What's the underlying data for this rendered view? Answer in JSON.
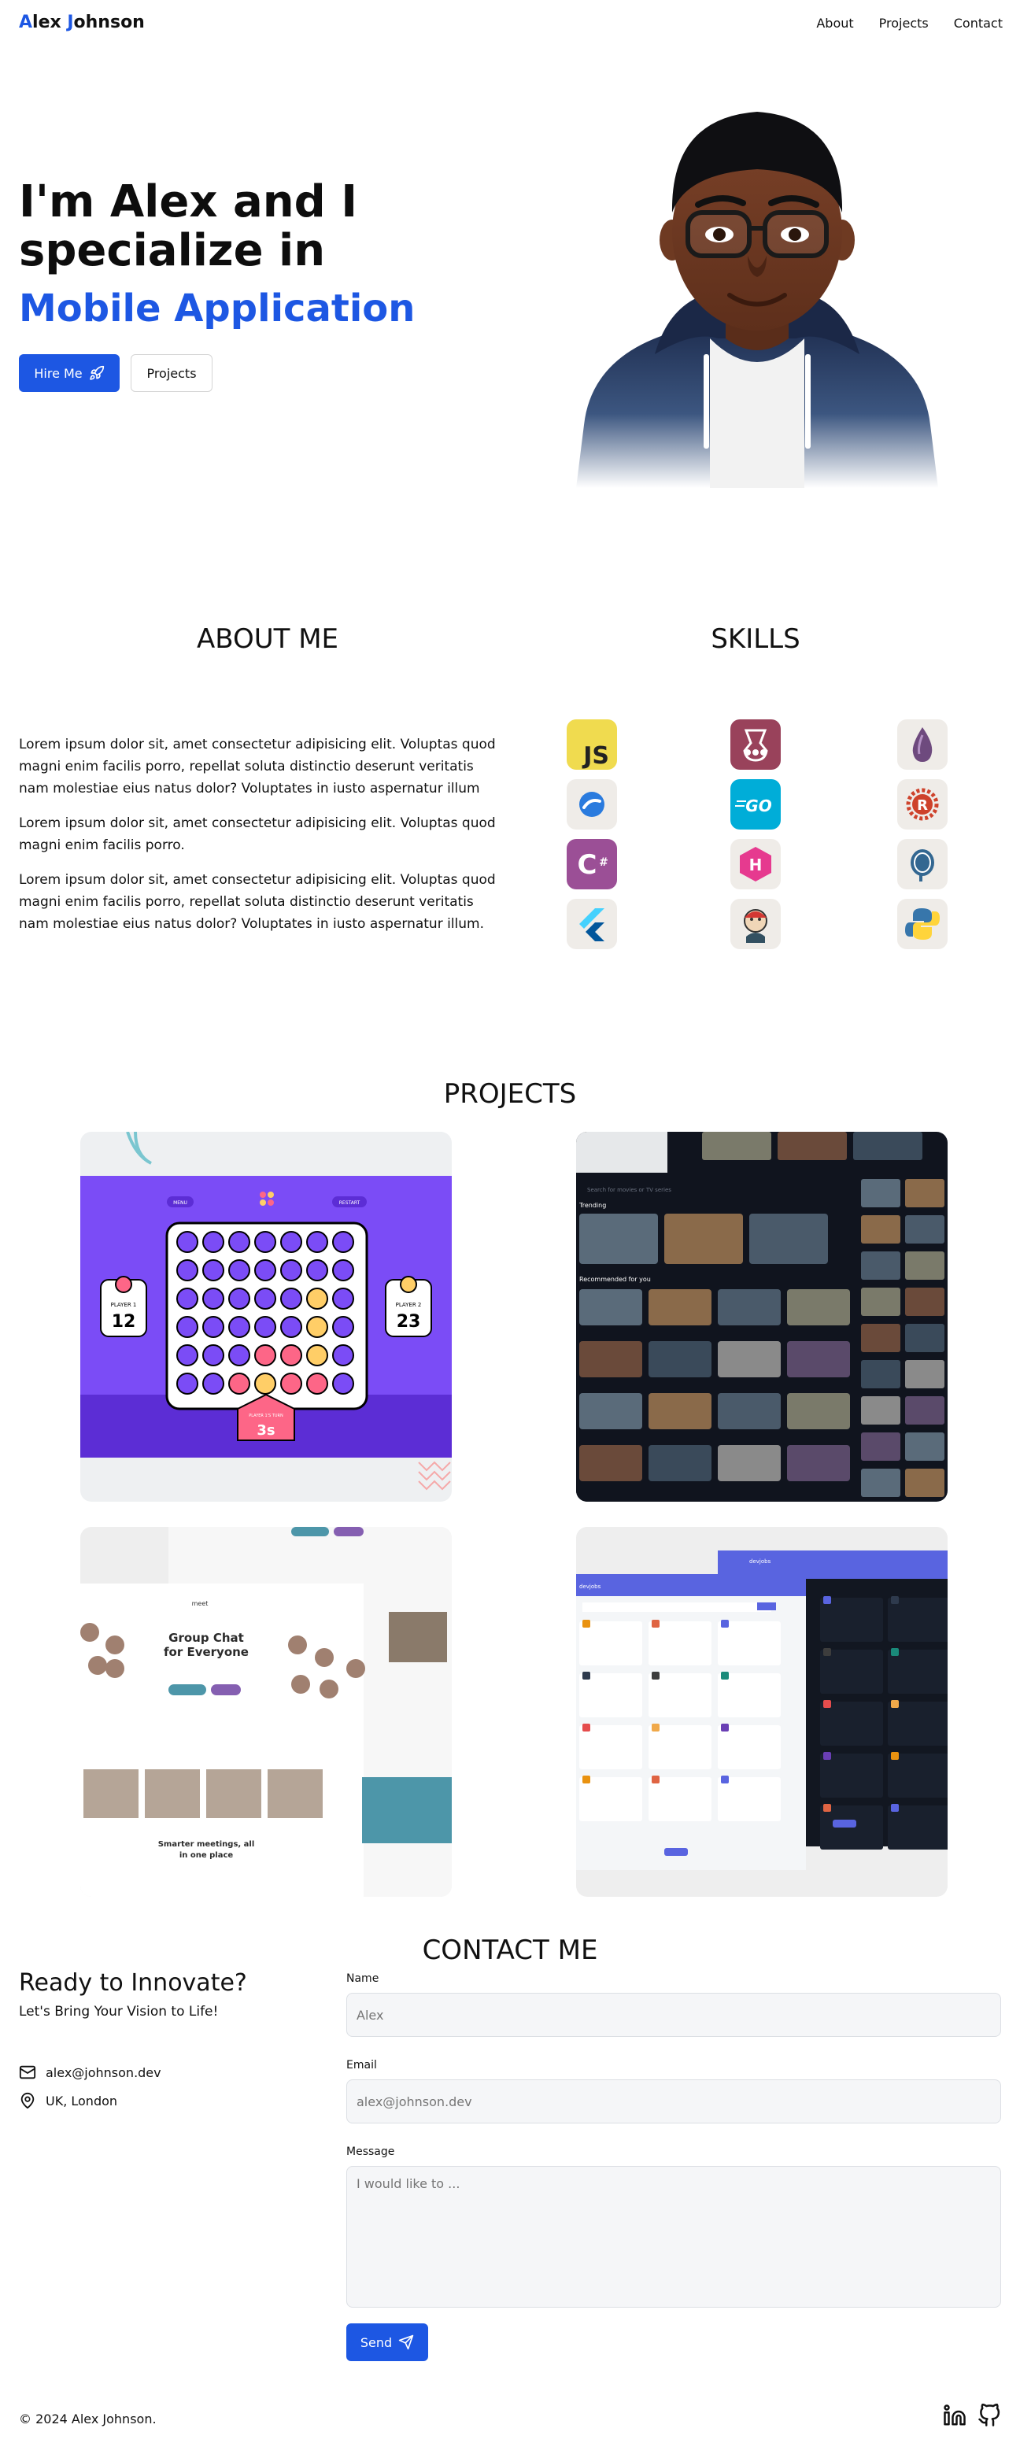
{
  "brand": {
    "first_initial": "A",
    "first_rest": "lex ",
    "last_initial": "J",
    "last_rest": "ohnson"
  },
  "nav": {
    "items": [
      "About",
      "Projects",
      "Contact"
    ]
  },
  "hero": {
    "title_line1": "I'm Alex and I",
    "title_line2": "specialize in",
    "role": "Mobile Application",
    "hire_label": "Hire Me",
    "projects_label": "Projects"
  },
  "about": {
    "title": "ABOUT ME",
    "paragraphs": [
      "Lorem ipsum dolor sit, amet consectetur adipisicing elit. Voluptas quod magni enim facilis porro, repellat soluta distinctio deserunt veritatis nam molestiae eius natus dolor? Voluptates in iusto aspernatur illum",
      "Lorem ipsum dolor sit, amet consectetur adipisicing elit. Voluptas quod magni enim facilis porro.",
      "Lorem ipsum dolor sit, amet consectetur adipisicing elit. Voluptas quod magni enim facilis porro, repellat soluta distinctio deserunt veritatis nam molestiae eius natus dolor? Voluptates in iusto aspernatur illum."
    ]
  },
  "skills": {
    "title": "SKILLS",
    "icons": [
      "javascript-icon",
      "jest-icon",
      "elixir-icon",
      "electron-icon",
      "go-icon",
      "rust-icon",
      "csharp-icon",
      "hack-icon",
      "postgresql-icon",
      "flutter-icon",
      "jenkins-icon",
      "python-icon"
    ]
  },
  "projects": {
    "title": "PROJECTS",
    "connect4": {
      "menu": "MENU",
      "restart": "RESTART",
      "player1": "PLAYER 1",
      "player1_score": "12",
      "player2": "PLAYER 2",
      "player2_score": "23",
      "turn": "PLAYER 1'S TURN",
      "timer": "3s"
    },
    "movies": {
      "search": "Search for movies or TV series",
      "trending": "Trending",
      "recommended": "Recommended for you"
    },
    "meet": {
      "brand": "meet",
      "title1": "Group Chat",
      "title2": "for Everyone",
      "tagline1": "Smarter meetings, all",
      "tagline2": "in one place"
    },
    "jobs": {
      "brand": "devjobs"
    }
  },
  "contact": {
    "title": "CONTACT ME",
    "heading": "Ready to Innovate?",
    "subheading": "Let's Bring Your Vision to Life!",
    "email": "alex@johnson.dev",
    "location": "UK, London",
    "name_label": "Name",
    "name_placeholder": "Alex",
    "email_label": "Email",
    "email_placeholder": "alex@johnson.dev",
    "message_label": "Message",
    "message_placeholder": "I would like to ...",
    "send_label": "Send"
  },
  "footer": {
    "copyright": "© 2024 Alex Johnson."
  },
  "colors": {
    "accent": "#1d57e3",
    "game_purple": "#7b4cf6",
    "movie_dark": "#10141e",
    "jobs_violet": "#5964e0"
  }
}
